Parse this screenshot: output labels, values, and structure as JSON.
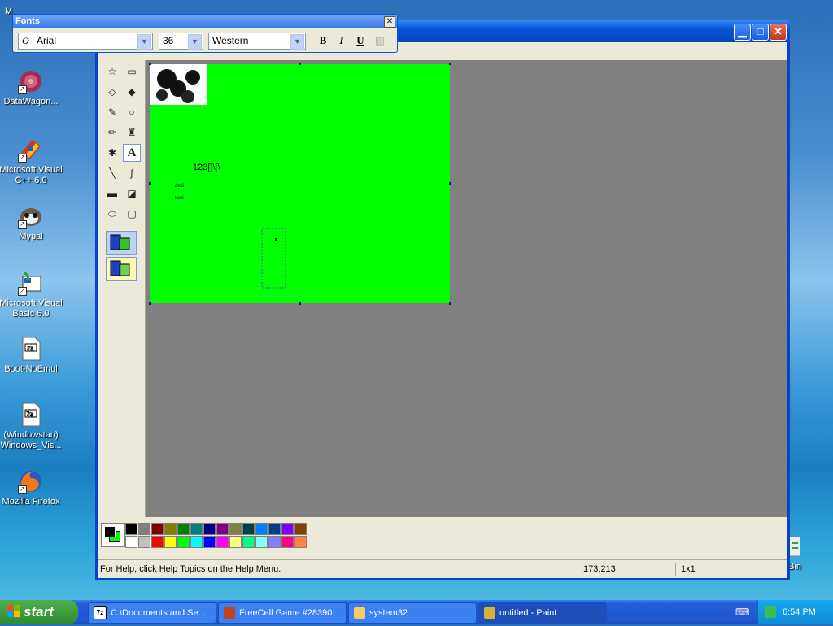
{
  "desktop": {
    "icons": [
      {
        "label": "DataWagon...",
        "icon": "datawagon-icon"
      },
      {
        "label": "Microsoft Visual C++ 6.0",
        "icon": "visual-cpp-icon"
      },
      {
        "label": "Mypal",
        "icon": "mypal-icon"
      },
      {
        "label": "Microsoft Visual Basic 6.0",
        "icon": "visual-basic-icon"
      },
      {
        "label": "Boot-NoEmul",
        "icon": "7z-file-icon"
      },
      {
        "label": "(Windowstan) Windows_Vis...",
        "icon": "7z-file-icon"
      },
      {
        "label": "Mozilla Firefox",
        "icon": "firefox-icon"
      }
    ],
    "partial_top_label": "M",
    "recycle_bin_label": "cle Bin"
  },
  "fonts_toolbar": {
    "title": "Fonts",
    "close_glyph": "✕",
    "font_name": "Arial",
    "font_glyph": "O",
    "font_size": "36",
    "script": "Western",
    "bold": "B",
    "italic": "I",
    "underline": "U"
  },
  "paint_window": {
    "minimize_glyph": "▁",
    "maximize_glyph": "□",
    "close_glyph": "✕",
    "canvas": {
      "background": "#00ff00",
      "text_lines": [
        "123[]\\[\\",
        "dkdi",
        "kcoi"
      ]
    },
    "status": {
      "help": "For Help, click Help Topics on the Help Menu.",
      "coords": "173,213",
      "size": "1x1"
    },
    "palette": {
      "top_row": [
        "#000000",
        "#808080",
        "#800000",
        "#808000",
        "#008000",
        "#008080",
        "#000080",
        "#800080",
        "#808040",
        "#004040",
        "#0080ff",
        "#004080",
        "#8000ff",
        "#804000"
      ],
      "bottom_row": [
        "#ffffff",
        "#c0c0c0",
        "#ff0000",
        "#ffff00",
        "#00ff00",
        "#00ffff",
        "#0000ff",
        "#ff00ff",
        "#ffff80",
        "#00ff80",
        "#80ffff",
        "#8080ff",
        "#ff0080",
        "#ff8040"
      ],
      "foreground": "#000000",
      "background": "#00ff00"
    }
  },
  "taskbar": {
    "start_label": "start",
    "tasks": [
      {
        "label": "C:\\Documents and Se...",
        "icon": "7z-icon"
      },
      {
        "label": "FreeCell Game #28390",
        "icon": "freecell-icon"
      },
      {
        "label": "system32",
        "icon": "folder-icon"
      },
      {
        "label": "untitled - Paint",
        "icon": "paint-icon"
      }
    ],
    "clock": "6:54 PM"
  }
}
